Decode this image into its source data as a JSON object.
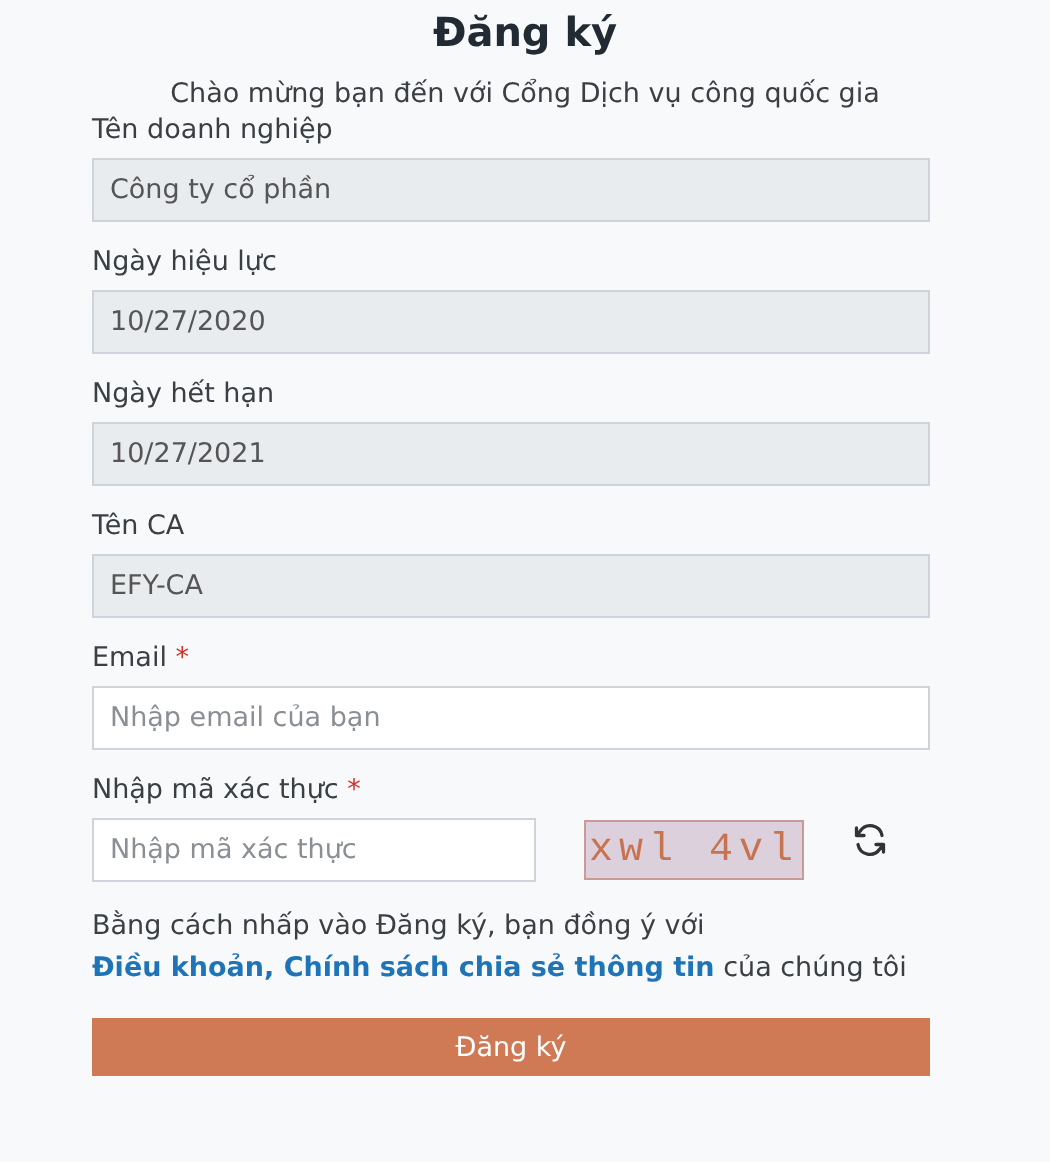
{
  "title": "Đăng ký",
  "subtitle": "Chào mừng bạn đến với Cổng Dịch vụ công quốc gia",
  "fields": [
    {
      "label": "Tên doanh nghiệp",
      "value": "Công ty cổ phần",
      "disabled": true
    },
    {
      "label": "Ngày hiệu lực",
      "value": "10/27/2020",
      "disabled": true
    },
    {
      "label": "Ngày hết hạn",
      "value": "10/27/2021",
      "disabled": true
    },
    {
      "label": "Tên CA",
      "value": "EFY-CA",
      "disabled": true
    },
    {
      "label": "Email",
      "placeholder": "Nhập email của bạn",
      "disabled": false,
      "required_mark": "*"
    }
  ],
  "captcha": {
    "label": "Nhập mã xác thực",
    "required_mark": "*",
    "placeholder": "Nhập mã xác thực",
    "code": "xwl 4vl"
  },
  "terms": {
    "text": "Bằng cách nhấp vào Đăng ký, bạn đồng ý với",
    "link": "Điều khoản, Chính sách chia sẻ thông tin",
    "suffix": "của chúng tôi"
  },
  "submit": "Đăng ký"
}
